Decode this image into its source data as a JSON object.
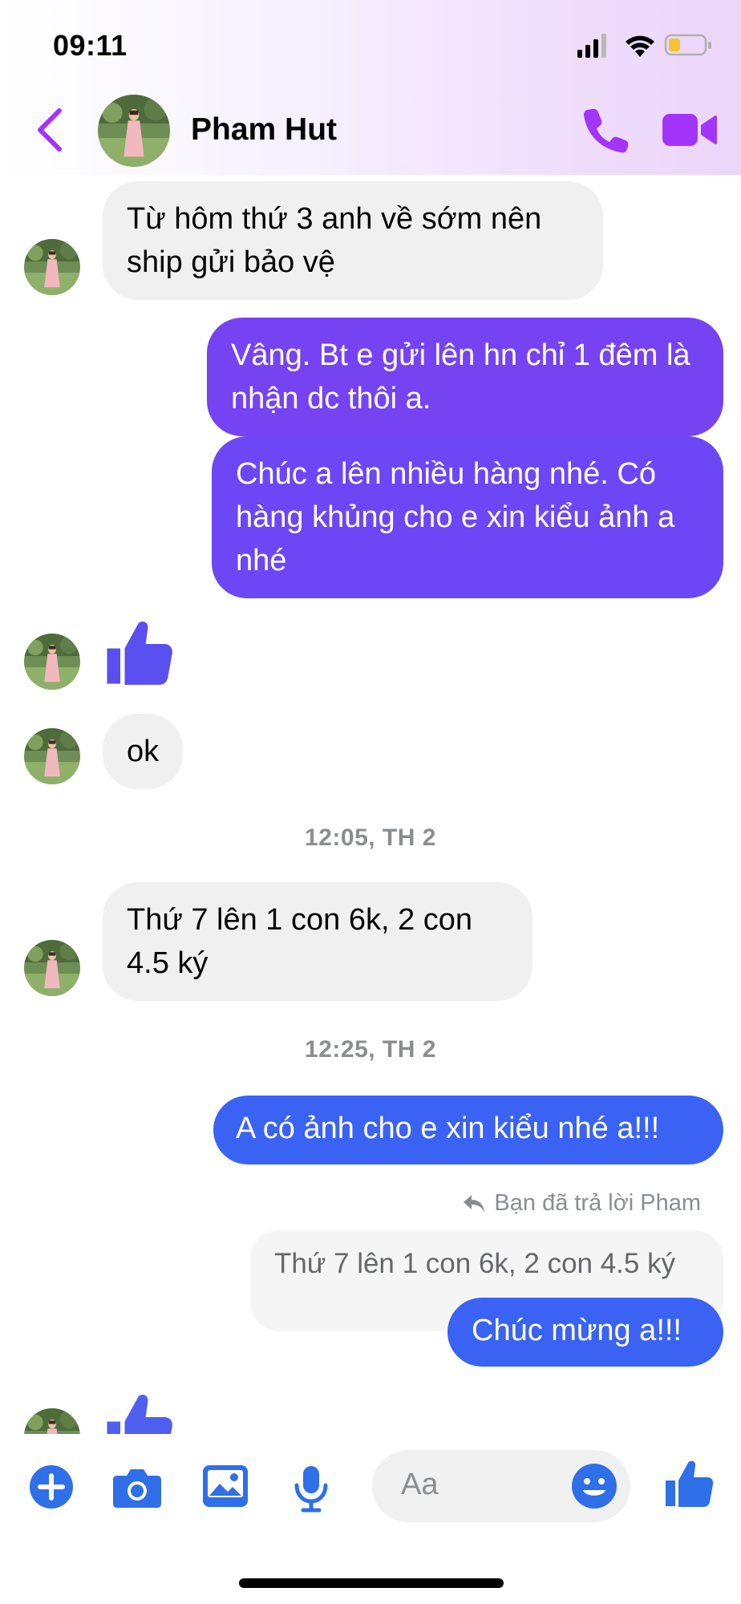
{
  "status_bar": {
    "time": "09:11",
    "icons": [
      "signal-icon",
      "wifi-icon",
      "battery-icon"
    ],
    "battery_color": "#f4c430"
  },
  "header": {
    "contact_name": "Pham Hut",
    "accent_color": "#a334fa",
    "actions": [
      "back-icon",
      "phone-icon",
      "video-camera-icon"
    ]
  },
  "messages": [
    {
      "from": "them",
      "text": "Từ hôm thứ 3 anh về sớm nên ship gửi bảo vệ"
    },
    {
      "from": "me",
      "text": "Vâng. Bt e gửi lên hn chỉ 1 đêm là nhận dc thôi a."
    },
    {
      "from": "me",
      "text": "Chúc a lên nhiều hàng nhé. Có hàng khủng cho e xin kiểu ảnh a nhé"
    },
    {
      "from": "them",
      "type": "like-sticker"
    },
    {
      "from": "them",
      "text": "ok"
    },
    {
      "divider": "12:05, TH 2"
    },
    {
      "from": "them",
      "text": "Thứ 7 lên 1 con 6k, 2 con 4.5 ký"
    },
    {
      "divider": "12:25, TH 2"
    },
    {
      "from": "me",
      "text": "A có ảnh cho e xin kiểu nhé a!!!"
    },
    {
      "reply_caption": "Bạn đã trả lời Pham",
      "quoted": "Thứ 7 lên 1 con 6k, 2 con 4.5 ký"
    },
    {
      "from": "me",
      "text": "Chúc mừng a!!!"
    },
    {
      "from": "them",
      "type": "like-sticker"
    }
  ],
  "composer": {
    "placeholder": "Aa",
    "buttons": [
      "plus-icon",
      "camera-icon",
      "gallery-icon",
      "microphone-icon",
      "emoji-icon",
      "like-icon"
    ],
    "icon_color": "#2f6fe8"
  }
}
